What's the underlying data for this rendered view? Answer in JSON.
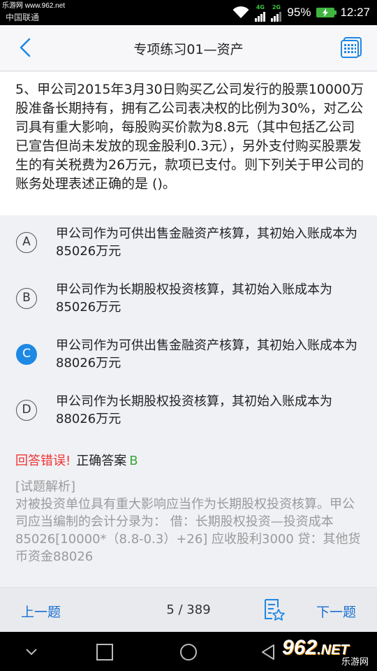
{
  "statusbar": {
    "watermark": "乐游网 www.962.net",
    "carrier": "中国联通",
    "net1": "4G",
    "net2": "2G",
    "battery_percent": "95%",
    "time": "12:27"
  },
  "header": {
    "title": "专项练习01—资产"
  },
  "question": {
    "text": "5、甲公司2015年3月30日购买乙公司发行的股票10000万股准备长期持有，拥有乙公司表决权的比例为30%，对乙公司具有重大影响，每股购买价款为8.8元（其中包括乙公司已宣告但尚未发放的现金股利0.3元），另外支付购买股票发生的有关税费为26万元，款项已支付。则下列关于甲公司的账务处理表述正确的是 ()。"
  },
  "options": [
    {
      "letter": "A",
      "text": "甲公司作为可供出售金融资产核算，其初始入账成本为85026万元",
      "selected": false
    },
    {
      "letter": "B",
      "text": "甲公司作为长期股权投资核算，其初始入账成本为85026万元",
      "selected": false
    },
    {
      "letter": "C",
      "text": "甲公司作为可供出售金融资产核算，其初始入账成本为88026万元",
      "selected": true
    },
    {
      "letter": "D",
      "text": "甲公司作为长期股权投资核算，其初始入账成本为88026万元",
      "selected": false
    }
  ],
  "answer": {
    "result": "回答错误!",
    "correct_label": "正确答案",
    "correct_value": "B"
  },
  "analysis": {
    "heading": "[试题解析]",
    "text": "对被投资单位具有重大影响应当作为长期股权投资核算。甲公司应当编制的会计分录为： 借：长期股权投资—投资成本85026[10000*（8.8-0.3）+26] 应收股利3000 贷：其他货币资金88026"
  },
  "bottom": {
    "prev_label": "上一题",
    "counter": "5 / 389",
    "next_label": "下一题"
  },
  "logo": {
    "number": "962",
    "net": ".NET",
    "subtitle": "乐游网"
  },
  "colors": {
    "accent": "#1e88e5",
    "wrong": "#ee3333",
    "correct": "#3ba63b",
    "link": "#1a6fd1"
  }
}
